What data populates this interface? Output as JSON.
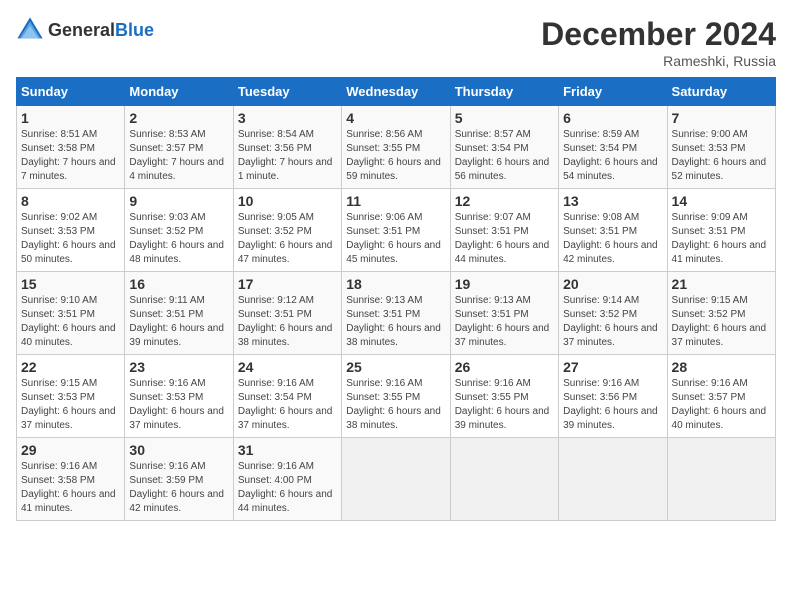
{
  "header": {
    "logo_general": "General",
    "logo_blue": "Blue",
    "title": "December 2024",
    "subtitle": "Rameshki, Russia"
  },
  "days_of_week": [
    "Sunday",
    "Monday",
    "Tuesday",
    "Wednesday",
    "Thursday",
    "Friday",
    "Saturday"
  ],
  "weeks": [
    [
      {
        "day": "1",
        "sunrise": "Sunrise: 8:51 AM",
        "sunset": "Sunset: 3:58 PM",
        "daylight": "Daylight: 7 hours and 7 minutes."
      },
      {
        "day": "2",
        "sunrise": "Sunrise: 8:53 AM",
        "sunset": "Sunset: 3:57 PM",
        "daylight": "Daylight: 7 hours and 4 minutes."
      },
      {
        "day": "3",
        "sunrise": "Sunrise: 8:54 AM",
        "sunset": "Sunset: 3:56 PM",
        "daylight": "Daylight: 7 hours and 1 minute."
      },
      {
        "day": "4",
        "sunrise": "Sunrise: 8:56 AM",
        "sunset": "Sunset: 3:55 PM",
        "daylight": "Daylight: 6 hours and 59 minutes."
      },
      {
        "day": "5",
        "sunrise": "Sunrise: 8:57 AM",
        "sunset": "Sunset: 3:54 PM",
        "daylight": "Daylight: 6 hours and 56 minutes."
      },
      {
        "day": "6",
        "sunrise": "Sunrise: 8:59 AM",
        "sunset": "Sunset: 3:54 PM",
        "daylight": "Daylight: 6 hours and 54 minutes."
      },
      {
        "day": "7",
        "sunrise": "Sunrise: 9:00 AM",
        "sunset": "Sunset: 3:53 PM",
        "daylight": "Daylight: 6 hours and 52 minutes."
      }
    ],
    [
      {
        "day": "8",
        "sunrise": "Sunrise: 9:02 AM",
        "sunset": "Sunset: 3:53 PM",
        "daylight": "Daylight: 6 hours and 50 minutes."
      },
      {
        "day": "9",
        "sunrise": "Sunrise: 9:03 AM",
        "sunset": "Sunset: 3:52 PM",
        "daylight": "Daylight: 6 hours and 48 minutes."
      },
      {
        "day": "10",
        "sunrise": "Sunrise: 9:05 AM",
        "sunset": "Sunset: 3:52 PM",
        "daylight": "Daylight: 6 hours and 47 minutes."
      },
      {
        "day": "11",
        "sunrise": "Sunrise: 9:06 AM",
        "sunset": "Sunset: 3:51 PM",
        "daylight": "Daylight: 6 hours and 45 minutes."
      },
      {
        "day": "12",
        "sunrise": "Sunrise: 9:07 AM",
        "sunset": "Sunset: 3:51 PM",
        "daylight": "Daylight: 6 hours and 44 minutes."
      },
      {
        "day": "13",
        "sunrise": "Sunrise: 9:08 AM",
        "sunset": "Sunset: 3:51 PM",
        "daylight": "Daylight: 6 hours and 42 minutes."
      },
      {
        "day": "14",
        "sunrise": "Sunrise: 9:09 AM",
        "sunset": "Sunset: 3:51 PM",
        "daylight": "Daylight: 6 hours and 41 minutes."
      }
    ],
    [
      {
        "day": "15",
        "sunrise": "Sunrise: 9:10 AM",
        "sunset": "Sunset: 3:51 PM",
        "daylight": "Daylight: 6 hours and 40 minutes."
      },
      {
        "day": "16",
        "sunrise": "Sunrise: 9:11 AM",
        "sunset": "Sunset: 3:51 PM",
        "daylight": "Daylight: 6 hours and 39 minutes."
      },
      {
        "day": "17",
        "sunrise": "Sunrise: 9:12 AM",
        "sunset": "Sunset: 3:51 PM",
        "daylight": "Daylight: 6 hours and 38 minutes."
      },
      {
        "day": "18",
        "sunrise": "Sunrise: 9:13 AM",
        "sunset": "Sunset: 3:51 PM",
        "daylight": "Daylight: 6 hours and 38 minutes."
      },
      {
        "day": "19",
        "sunrise": "Sunrise: 9:13 AM",
        "sunset": "Sunset: 3:51 PM",
        "daylight": "Daylight: 6 hours and 37 minutes."
      },
      {
        "day": "20",
        "sunrise": "Sunrise: 9:14 AM",
        "sunset": "Sunset: 3:52 PM",
        "daylight": "Daylight: 6 hours and 37 minutes."
      },
      {
        "day": "21",
        "sunrise": "Sunrise: 9:15 AM",
        "sunset": "Sunset: 3:52 PM",
        "daylight": "Daylight: 6 hours and 37 minutes."
      }
    ],
    [
      {
        "day": "22",
        "sunrise": "Sunrise: 9:15 AM",
        "sunset": "Sunset: 3:53 PM",
        "daylight": "Daylight: 6 hours and 37 minutes."
      },
      {
        "day": "23",
        "sunrise": "Sunrise: 9:16 AM",
        "sunset": "Sunset: 3:53 PM",
        "daylight": "Daylight: 6 hours and 37 minutes."
      },
      {
        "day": "24",
        "sunrise": "Sunrise: 9:16 AM",
        "sunset": "Sunset: 3:54 PM",
        "daylight": "Daylight: 6 hours and 37 minutes."
      },
      {
        "day": "25",
        "sunrise": "Sunrise: 9:16 AM",
        "sunset": "Sunset: 3:55 PM",
        "daylight": "Daylight: 6 hours and 38 minutes."
      },
      {
        "day": "26",
        "sunrise": "Sunrise: 9:16 AM",
        "sunset": "Sunset: 3:55 PM",
        "daylight": "Daylight: 6 hours and 39 minutes."
      },
      {
        "day": "27",
        "sunrise": "Sunrise: 9:16 AM",
        "sunset": "Sunset: 3:56 PM",
        "daylight": "Daylight: 6 hours and 39 minutes."
      },
      {
        "day": "28",
        "sunrise": "Sunrise: 9:16 AM",
        "sunset": "Sunset: 3:57 PM",
        "daylight": "Daylight: 6 hours and 40 minutes."
      }
    ],
    [
      {
        "day": "29",
        "sunrise": "Sunrise: 9:16 AM",
        "sunset": "Sunset: 3:58 PM",
        "daylight": "Daylight: 6 hours and 41 minutes."
      },
      {
        "day": "30",
        "sunrise": "Sunrise: 9:16 AM",
        "sunset": "Sunset: 3:59 PM",
        "daylight": "Daylight: 6 hours and 42 minutes."
      },
      {
        "day": "31",
        "sunrise": "Sunrise: 9:16 AM",
        "sunset": "Sunset: 4:00 PM",
        "daylight": "Daylight: 6 hours and 44 minutes."
      },
      null,
      null,
      null,
      null
    ]
  ]
}
